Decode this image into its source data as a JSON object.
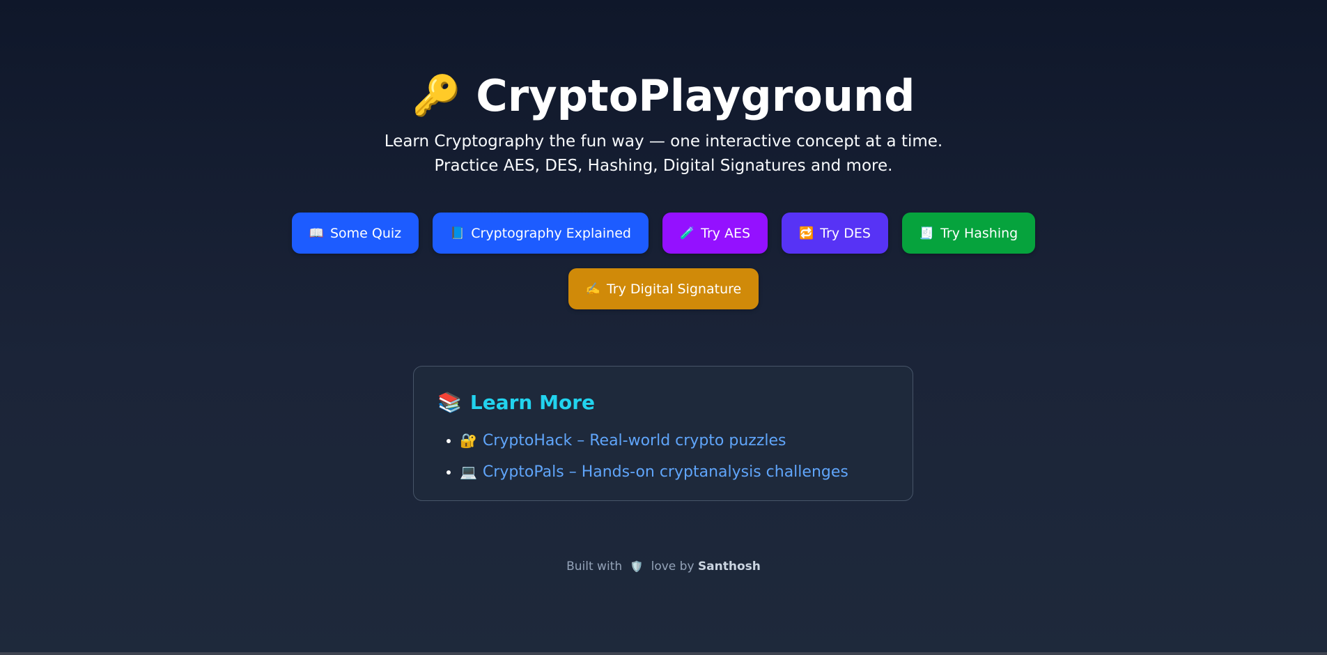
{
  "hero": {
    "title_icon": "🔑",
    "title": "CryptoPlayground",
    "subtitle_line1": "Learn Cryptography the fun way — one interactive concept at a time.",
    "subtitle_line2": "Practice AES, DES, Hashing, Digital Signatures and more."
  },
  "buttons": [
    {
      "icon": "📖",
      "label": "Some Quiz",
      "color": "#1d5cff"
    },
    {
      "icon": "📘",
      "label": "Cryptography Explained",
      "color": "#1d5cff"
    },
    {
      "icon": "🧪",
      "label": "Try AES",
      "color": "#9411ff"
    },
    {
      "icon": "🔁",
      "label": "Try DES",
      "color": "#5733f5"
    },
    {
      "icon": "🧾",
      "label": "Try Hashing",
      "color": "#06a33d"
    },
    {
      "icon": "✍️",
      "label": "Try Digital Signature",
      "color": "#d08a09"
    }
  ],
  "learn_more": {
    "icon": "📚",
    "heading": "Learn More",
    "links": [
      {
        "icon": "🔐",
        "text": "CryptoHack – Real-world crypto puzzles"
      },
      {
        "icon": "💻",
        "text": "CryptoPals – Hands-on cryptanalysis challenges"
      }
    ]
  },
  "footer": {
    "prefix": "Built with",
    "icon": "🛡️",
    "middle": "love by",
    "author": "Santhosh"
  }
}
